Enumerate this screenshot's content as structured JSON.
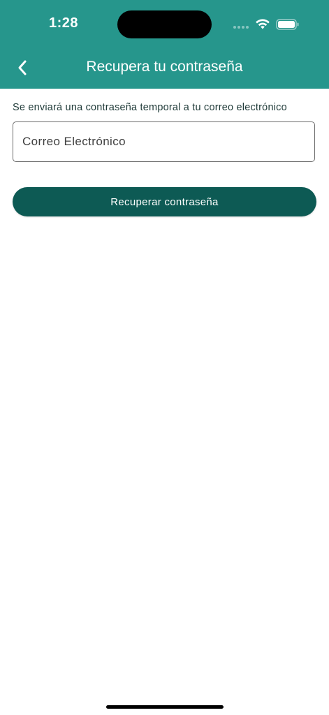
{
  "status_bar": {
    "time": "1:28"
  },
  "nav": {
    "title": "Recupera tu contraseña",
    "back_icon": "chevron-left-icon"
  },
  "form": {
    "description": "Se enviará una contraseña temporal a tu correo electrónico",
    "email_placeholder": "Correo Electrónico",
    "email_value": "",
    "submit_label": "Recuperar contraseña"
  },
  "colors": {
    "header": "#26968c",
    "button": "#0d5a54",
    "text": "#1f3a38"
  }
}
